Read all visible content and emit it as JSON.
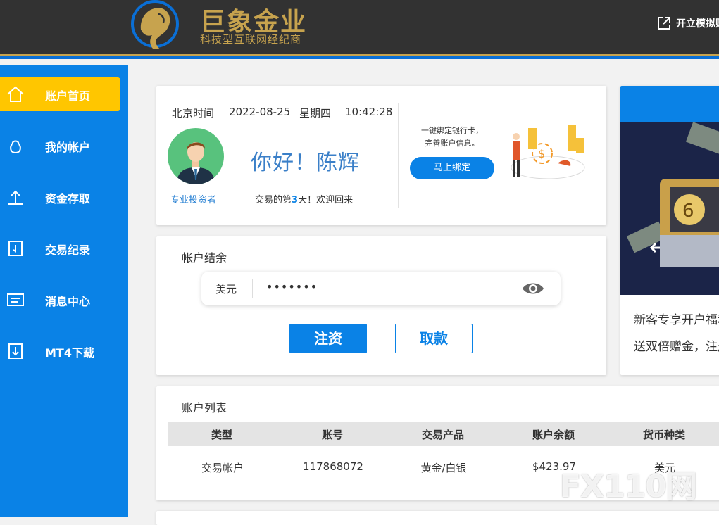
{
  "header": {
    "brand_name": "巨象金业",
    "brand_slogan": "科技型互联网经纪商",
    "open_demo_label": "开立模拟账户",
    "colors": {
      "bar": "#323232",
      "gold": "#c7a34e",
      "accent": "#0a6fd6"
    }
  },
  "sidebar": {
    "items": [
      {
        "label": "账户首页",
        "icon": "home-icon",
        "active": true
      },
      {
        "label": "我的帐户",
        "icon": "user-icon",
        "active": false
      },
      {
        "label": "资金存取",
        "icon": "upload-icon",
        "active": false
      },
      {
        "label": "交易纪录",
        "icon": "history-icon",
        "active": false
      },
      {
        "label": "消息中心",
        "icon": "message-icon",
        "active": false
      },
      {
        "label": "MT4下载",
        "icon": "download-icon",
        "active": false
      }
    ],
    "colors": {
      "bg": "#0a82e6",
      "active": "#ffc600"
    }
  },
  "welcome": {
    "time_label": "北京时间",
    "date": "2022-08-25",
    "weekday": "星期四",
    "time": "10:42:28",
    "role": "专业投资者",
    "greeting": "你好！陈辉",
    "days_prefix": "交易的第",
    "days_count": "3",
    "days_suffix": "天！欢迎回来",
    "bind_line1": "一键绑定银行卡，",
    "bind_line2": "完善账户信息。",
    "bind_button": "马上绑定"
  },
  "balance": {
    "title": "帐户结余",
    "currency": "美元",
    "masked_value": "•••••••",
    "deposit_button": "注资",
    "withdraw_button": "取款"
  },
  "promo": {
    "line1": "新客专享开户福利",
    "line2": "送双倍赠金，注册即享"
  },
  "accounts": {
    "title": "账户列表",
    "columns": [
      "类型",
      "账号",
      "交易产品",
      "账户余额",
      "货币种类"
    ],
    "rows": [
      [
        "交易帐户",
        "117868072",
        "黄金/白银",
        "$423.97",
        "美元"
      ]
    ]
  },
  "watermark": "FX110网"
}
